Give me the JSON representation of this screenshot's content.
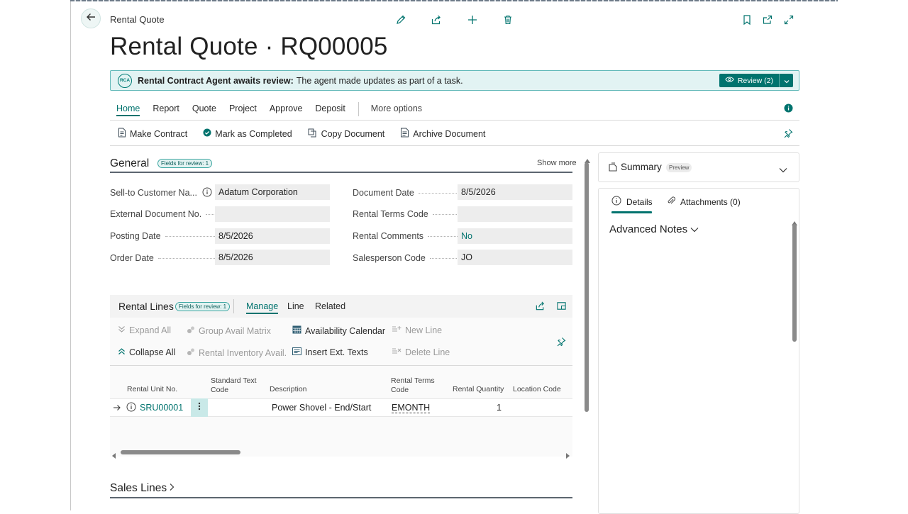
{
  "header": {
    "breadcrumb": "Rental Quote",
    "title": "Rental Quote · RQ00005",
    "toolbar_icons": [
      "edit-icon",
      "share-icon",
      "add-icon",
      "delete-icon"
    ],
    "right_icons": [
      "bookmark-icon",
      "open-new-window-icon",
      "expand-icon"
    ]
  },
  "banner": {
    "badge": "RCA",
    "bold_text": "Rental Contract Agent awaits review:",
    "text": "The agent made updates as part of a task.",
    "review_label": "Review (2)"
  },
  "menu": {
    "items": [
      "Home",
      "Report",
      "Quote",
      "Project",
      "Approve",
      "Deposit"
    ],
    "more": "More options"
  },
  "actions": [
    "Make Contract",
    "Mark as Completed",
    "Copy Document",
    "Archive Document"
  ],
  "general": {
    "title": "General",
    "badge": "Fields for review: 1",
    "show_more": "Show more",
    "left_fields": [
      {
        "label": "Sell-to Customer Na...",
        "value": "Adatum Corporation"
      },
      {
        "label": "External Document No.",
        "value": ""
      },
      {
        "label": "Posting Date",
        "value": "8/5/2026"
      },
      {
        "label": "Order Date",
        "value": "8/5/2026"
      }
    ],
    "right_fields": [
      {
        "label": "Document Date",
        "value": "8/5/2026"
      },
      {
        "label": "Rental Terms Code",
        "value": ""
      },
      {
        "label": "Rental Comments",
        "value": "No"
      },
      {
        "label": "Salesperson Code",
        "value": "JO"
      }
    ]
  },
  "rental_lines": {
    "title": "Rental Lines",
    "badge": "Fields for review: 1",
    "tabs": [
      "Manage",
      "Line",
      "Related"
    ],
    "actions": {
      "expand_all": "Expand All",
      "collapse_all": "Collapse All",
      "group_avail": "Group Avail Matrix",
      "rental_inventory": "Rental Inventory Avail.",
      "availability_calendar": "Availability Calendar",
      "insert_ext_texts": "Insert Ext. Texts",
      "new_line": "New Line",
      "delete_line": "Delete Line"
    },
    "columns": {
      "unit_no": "Rental Unit No.",
      "std_text_1": "Standard Text",
      "std_text_2": "Code",
      "description": "Description",
      "terms_1": "Rental Terms",
      "terms_2": "Code",
      "quantity": "Rental Quantity",
      "location": "Location Code"
    },
    "row": {
      "unit_no": "SRU00001",
      "description": "Power Shovel - End/Start",
      "terms": "EMONTH",
      "quantity": "1"
    }
  },
  "sales_lines": {
    "title": "Sales Lines"
  },
  "summary": {
    "title": "Summary",
    "preview": "Preview",
    "tabs": [
      "Details",
      "Attachments (0)"
    ],
    "advanced_notes": "Advanced Notes"
  },
  "colors": {
    "accent": "#00736e",
    "banner_bg": "#e2f3f3"
  }
}
